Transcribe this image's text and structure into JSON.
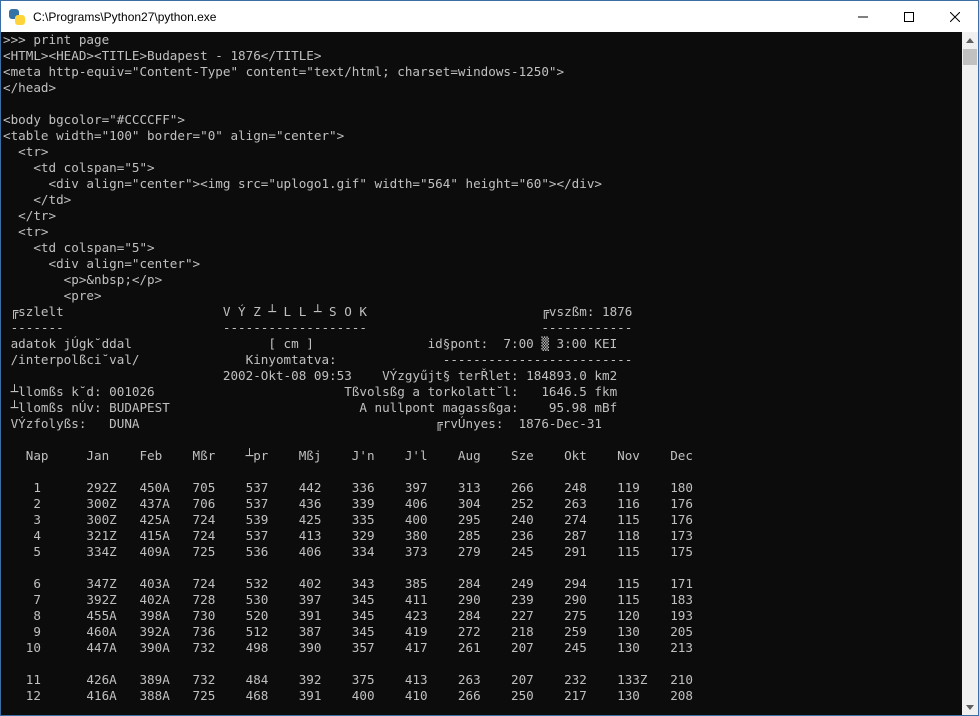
{
  "window": {
    "title": "C:\\Programs\\Python27\\python.exe"
  },
  "console": {
    "lines": [
      ">>> print page",
      "<HTML><HEAD><TITLE>Budapest - 1876</TITLE>",
      "<meta http-equiv=\"Content-Type\" content=\"text/html; charset=windows-1250\">",
      "</head>",
      "",
      "<body bgcolor=\"#CCCCFF\">",
      "<table width=\"100\" border=\"0\" align=\"center\">",
      "  <tr>",
      "    <td colspan=\"5\">",
      "      <div align=\"center\"><img src=\"uplogo1.gif\" width=\"564\" height=\"60\"></div>",
      "    </td>",
      "  </tr>",
      "  <tr>",
      "    <td colspan=\"5\">",
      "      <div align=\"center\">",
      "        <p>&nbsp;</p>",
      "        <pre>",
      " ╔szlelt                     V Ý Z ┴ L L ┴ S O K                       ╔vszßm: 1876",
      " -------                     -------------------                       ------------",
      " adatok jÚgk˘ddal                  [ cm ]               id§pont:  7:00 ▒ 3:00 KEI",
      " /interpolßci˘val/              Kinyomtatva:              -------------------------",
      "                             2002-Okt-08 09:53    VÝzgyűjt§ terŘlet: 184893.0 km2",
      " ┴llomßs k˘d: 001026                         Tßvolsßg a torkolatt˘l:   1646.5 fkm",
      " ┴llomßs nÚv: BUDAPEST                         A nullpont magassßga:    95.98 mBf",
      " VÝzfolyßs:   DUNA                                       ╔rvÚnyes:  1876-Dec-31",
      "",
      "   Nap     Jan    Feb    Mßr    ┴pr    Mßj    J'n    J'l    Aug    Sze    Okt    Nov    Dec",
      "",
      "    1      292Z   450A   705    537    442    336    397    313    266    248    119    180",
      "    2      300Z   437A   706    537    436    339    406    304    252    263    116    176",
      "    3      300Z   425A   724    539    425    335    400    295    240    274    115    176",
      "    4      321Z   415A   724    537    413    329    380    285    236    287    118    173",
      "    5      334Z   409A   725    536    406    334    373    279    245    291    115    175",
      "",
      "    6      347Z   403A   724    532    402    343    385    284    249    294    115    171",
      "    7      392Z   402A   728    530    397    345    411    290    239    290    115    183",
      "    8      455A   398A   730    520    391    345    423    284    227    275    120    193",
      "    9      460A   392A   736    512    387    345    419    272    218    259    130    205",
      "   10      447A   390A   732    498    390    357    417    261    207    245    130    213",
      "",
      "   11      426A   389A   732    484    392    375    413    263    207    232    133Z   210",
      "   12      416A   388A   725    468    391    400    410    266    250    217    130    208"
    ]
  },
  "colors": {
    "console_bg": "#0c0c0c",
    "console_fg": "#c0c0c0",
    "titlebar_bg": "#ffffff"
  }
}
